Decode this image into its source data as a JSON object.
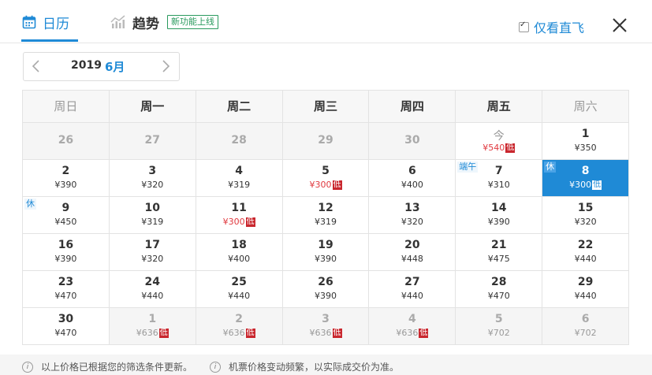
{
  "header": {
    "tab_calendar": "日历",
    "tab_trend": "趋势",
    "new_badge": "新功能上线",
    "direct_only_label": "仅看直飞",
    "direct_only_checked": true,
    "accent_color": "#1f8ad6"
  },
  "month_picker": {
    "year": "2019",
    "month": "6月"
  },
  "weekdays": [
    "周日",
    "周一",
    "周二",
    "周三",
    "周四",
    "周五",
    "周六"
  ],
  "weeks": [
    [
      {
        "day": "26",
        "price": "",
        "low": false,
        "disabled": true
      },
      {
        "day": "27",
        "price": "",
        "low": false,
        "disabled": true
      },
      {
        "day": "28",
        "price": "",
        "low": false,
        "disabled": true
      },
      {
        "day": "29",
        "price": "",
        "low": false,
        "disabled": true
      },
      {
        "day": "30",
        "price": "",
        "low": false,
        "disabled": true
      },
      {
        "day": "今",
        "price": "¥540",
        "low": true,
        "disabled": false,
        "today": true
      },
      {
        "day": "1",
        "price": "¥350",
        "low": false,
        "disabled": false
      }
    ],
    [
      {
        "day": "2",
        "price": "¥390",
        "low": false,
        "disabled": false
      },
      {
        "day": "3",
        "price": "¥320",
        "low": false,
        "disabled": false
      },
      {
        "day": "4",
        "price": "¥319",
        "low": false,
        "disabled": false
      },
      {
        "day": "5",
        "price": "¥300",
        "low": true,
        "disabled": false
      },
      {
        "day": "6",
        "price": "¥400",
        "low": false,
        "disabled": false
      },
      {
        "day": "7",
        "price": "¥310",
        "low": false,
        "disabled": false,
        "tag": "端午"
      },
      {
        "day": "8",
        "price": "¥300",
        "low": true,
        "disabled": false,
        "selected": true,
        "tag": "休"
      }
    ],
    [
      {
        "day": "9",
        "price": "¥450",
        "low": false,
        "disabled": false,
        "tag": "休"
      },
      {
        "day": "10",
        "price": "¥319",
        "low": false,
        "disabled": false
      },
      {
        "day": "11",
        "price": "¥300",
        "low": true,
        "disabled": false
      },
      {
        "day": "12",
        "price": "¥319",
        "low": false,
        "disabled": false
      },
      {
        "day": "13",
        "price": "¥320",
        "low": false,
        "disabled": false
      },
      {
        "day": "14",
        "price": "¥390",
        "low": false,
        "disabled": false
      },
      {
        "day": "15",
        "price": "¥320",
        "low": false,
        "disabled": false
      }
    ],
    [
      {
        "day": "16",
        "price": "¥390",
        "low": false,
        "disabled": false
      },
      {
        "day": "17",
        "price": "¥320",
        "low": false,
        "disabled": false
      },
      {
        "day": "18",
        "price": "¥400",
        "low": false,
        "disabled": false
      },
      {
        "day": "19",
        "price": "¥390",
        "low": false,
        "disabled": false
      },
      {
        "day": "20",
        "price": "¥448",
        "low": false,
        "disabled": false
      },
      {
        "day": "21",
        "price": "¥475",
        "low": false,
        "disabled": false
      },
      {
        "day": "22",
        "price": "¥440",
        "low": false,
        "disabled": false
      }
    ],
    [
      {
        "day": "23",
        "price": "¥470",
        "low": false,
        "disabled": false
      },
      {
        "day": "24",
        "price": "¥440",
        "low": false,
        "disabled": false
      },
      {
        "day": "25",
        "price": "¥440",
        "low": false,
        "disabled": false
      },
      {
        "day": "26",
        "price": "¥390",
        "low": false,
        "disabled": false
      },
      {
        "day": "27",
        "price": "¥440",
        "low": false,
        "disabled": false
      },
      {
        "day": "28",
        "price": "¥470",
        "low": false,
        "disabled": false
      },
      {
        "day": "29",
        "price": "¥440",
        "low": false,
        "disabled": false
      }
    ],
    [
      {
        "day": "30",
        "price": "¥470",
        "low": false,
        "disabled": false
      },
      {
        "day": "1",
        "price": "¥636",
        "low": true,
        "disabled": true
      },
      {
        "day": "2",
        "price": "¥636",
        "low": true,
        "disabled": true
      },
      {
        "day": "3",
        "price": "¥636",
        "low": true,
        "disabled": true
      },
      {
        "day": "4",
        "price": "¥636",
        "low": true,
        "disabled": true
      },
      {
        "day": "5",
        "price": "¥702",
        "low": false,
        "disabled": true
      },
      {
        "day": "6",
        "price": "¥702",
        "low": false,
        "disabled": true
      }
    ]
  ],
  "low_label": "低",
  "footer": {
    "note1": "以上价格已根据您的筛选条件更新。",
    "note2": "机票价格变动频繁，以实际成交价为准。"
  }
}
